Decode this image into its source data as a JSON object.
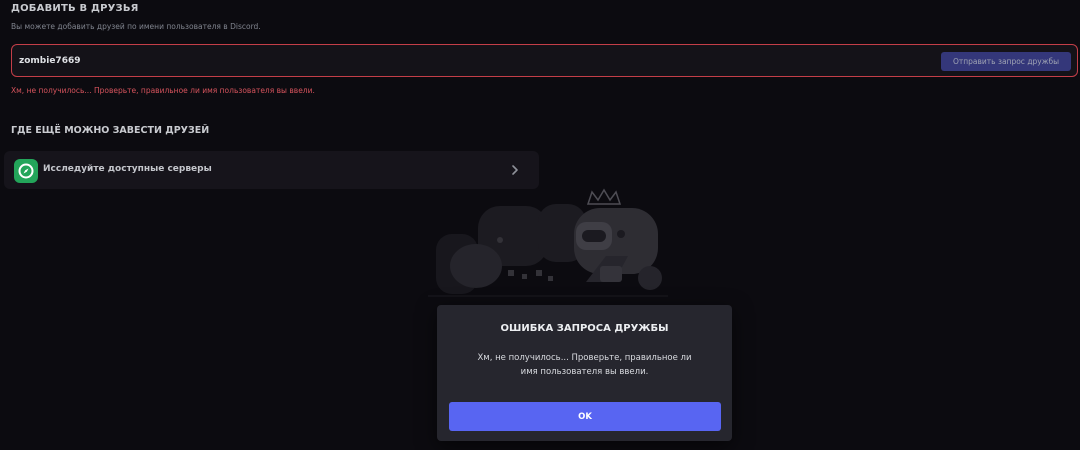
{
  "add_friend": {
    "title": "ДОБАВИТЬ В ДРУЗЬЯ",
    "description": "Вы можете добавить друзей по имени пользователя в Discord.",
    "input_value": "zombie7669",
    "send_button_label": "Отправить запрос дружбы",
    "error_text": "Хм, не получилось... Проверьте, правильное ли имя пользователя вы ввели."
  },
  "discover": {
    "title": "ГДЕ ЕЩЁ МОЖНО ЗАВЕСТИ ДРУЗЕЙ",
    "explore_label": "Исследуйте доступные серверы",
    "explore_icon": "compass-icon",
    "chevron_icon": "chevron-right-icon"
  },
  "modal": {
    "title": "ОШИБКА ЗАПРОСА ДРУЖБЫ",
    "body": "Хм, не получилось... Проверьте, правильное ли имя пользователя вы ввели.",
    "ok_label": "OK"
  },
  "colors": {
    "accent": "#5865f2",
    "error": "#d5535c",
    "background": "#0c0b10",
    "explore_icon_bg": "#23a55a"
  }
}
